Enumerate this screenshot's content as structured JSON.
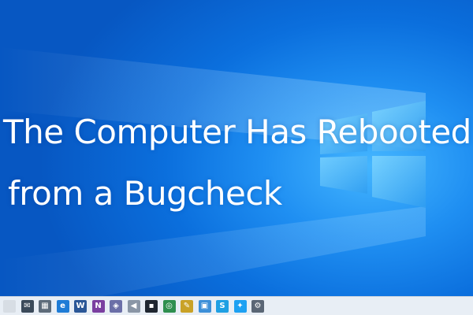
{
  "headline": {
    "line1": "The Computer Has Rebooted",
    "line2": "from a Bugcheck"
  },
  "colors": {
    "background": "#0b6fdd",
    "logo": "#5cc8ff",
    "text": "#ffffff",
    "taskbar": "#e8eef5"
  },
  "taskbar": {
    "icons": [
      {
        "name": "file-explorer-icon",
        "glyph": "",
        "color": "#d7dde4"
      },
      {
        "name": "mail-icon",
        "glyph": "✉",
        "color": "#3b4a5a"
      },
      {
        "name": "calendar-icon",
        "glyph": "▦",
        "color": "#5d6b7a"
      },
      {
        "name": "edge-icon",
        "glyph": "e",
        "color": "#1e7cd6"
      },
      {
        "name": "word-icon",
        "glyph": "W",
        "color": "#2b5797"
      },
      {
        "name": "onenote-icon",
        "glyph": "N",
        "color": "#7b3fa0"
      },
      {
        "name": "app-icon",
        "glyph": "◈",
        "color": "#6b6fa8"
      },
      {
        "name": "sound-icon",
        "glyph": "◀",
        "color": "#8a96a6"
      },
      {
        "name": "terminal-icon",
        "glyph": "▪",
        "color": "#1f2630"
      },
      {
        "name": "app-green-icon",
        "glyph": "◎",
        "color": "#2e8f4f"
      },
      {
        "name": "paint-icon",
        "glyph": "✎",
        "color": "#c9a227"
      },
      {
        "name": "photos-icon",
        "glyph": "▣",
        "color": "#3c8fd8"
      },
      {
        "name": "skype-icon",
        "glyph": "S",
        "color": "#1fa0e3"
      },
      {
        "name": "twitter-icon",
        "glyph": "✦",
        "color": "#1da1f2"
      },
      {
        "name": "settings-gear-icon",
        "glyph": "⚙",
        "color": "#5a6675"
      }
    ]
  }
}
